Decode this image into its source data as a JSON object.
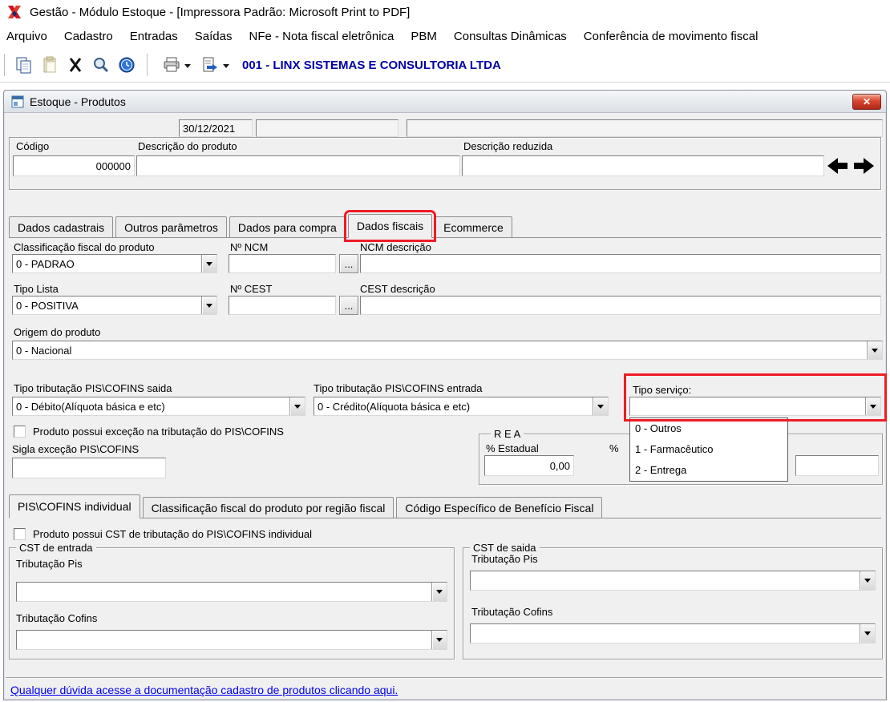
{
  "app": {
    "title": "Gestão  - Módulo Estoque - [Impressora Padrão: Microsoft Print to PDF]",
    "company": "001 - LINX SISTEMAS E CONSULTORIA LTDA"
  },
  "menu": {
    "items": [
      "Arquivo",
      "Cadastro",
      "Entradas",
      "Saídas",
      "NFe - Nota fiscal eletrônica",
      "PBM",
      "Consultas Dinâmicas",
      "Conferência de movimento fiscal"
    ]
  },
  "window": {
    "title": "Estoque - Produtos",
    "close_glyph": "✕",
    "date_value": "30/12/2021"
  },
  "header": {
    "codigo_label": "Código",
    "codigo_value": "000000",
    "descricao_label": "Descrição  do produto",
    "descricao_reduzida_label": "Descrição reduzida"
  },
  "tabs": {
    "items": [
      "Dados cadastrais",
      "Outros parâmetros",
      "Dados para compra",
      "Dados fiscais",
      "Ecommerce"
    ],
    "active": "Dados fiscais"
  },
  "fiscal": {
    "classificacao_label": "Classificação fiscal do produto",
    "classificacao_value": "0 - PADRAO",
    "ncm_label": "Nº NCM",
    "ncm_browse_label": "...",
    "ncm_desc_label": "NCM descrição",
    "tipo_lista_label": "Tipo Lista",
    "tipo_lista_value": "0 - POSITIVA",
    "cest_label": "Nº CEST",
    "cest_browse_label": "...",
    "cest_desc_label": "CEST descrição",
    "origem_label": "Origem do produto",
    "origem_value": "0 - Nacional",
    "pis_saida_label": "Tipo tributação PIS\\COFINS saida",
    "pis_saida_value": "0 - Débito(Alíquota básica e etc)",
    "pis_entrada_label": "Tipo tributação PIS\\COFINS entrada",
    "pis_entrada_value": "0 - Crédito(Alíquota básica e etc)",
    "tipo_servico_label": "Tipo serviço:",
    "tipo_servico_value": "",
    "tipo_servico_options": [
      "0 - Outros",
      "1 - Farmacêutico",
      "2 - Entrega"
    ],
    "excecao_checkbox_label": "Produto possui exceção na tributação do PIS\\COFINS",
    "sigla_label": "Sigla exceção PIS\\COFINS",
    "rea": {
      "title": "R E A",
      "estadual_label": "% Estadual",
      "estadual_value": "0,00",
      "federal_label": "%"
    }
  },
  "subtabs": {
    "items": [
      "PIS\\COFINS individual",
      "Classificação fiscal do produto por região fiscal",
      "Código Específico de Benefício Fiscal"
    ],
    "active": "PIS\\COFINS individual"
  },
  "cst": {
    "checkbox_label": "Produto possui CST de tributação do PIS\\COFINS individual",
    "entrada_title": "CST de entrada",
    "saida_title": "CST de saida",
    "pis_label": "Tributação Pis",
    "cofins_label": "Tributação Cofins"
  },
  "footer": {
    "link_text": "Qualquer dúvida acesse a documentação cadastro de produtos clicando aqui."
  }
}
